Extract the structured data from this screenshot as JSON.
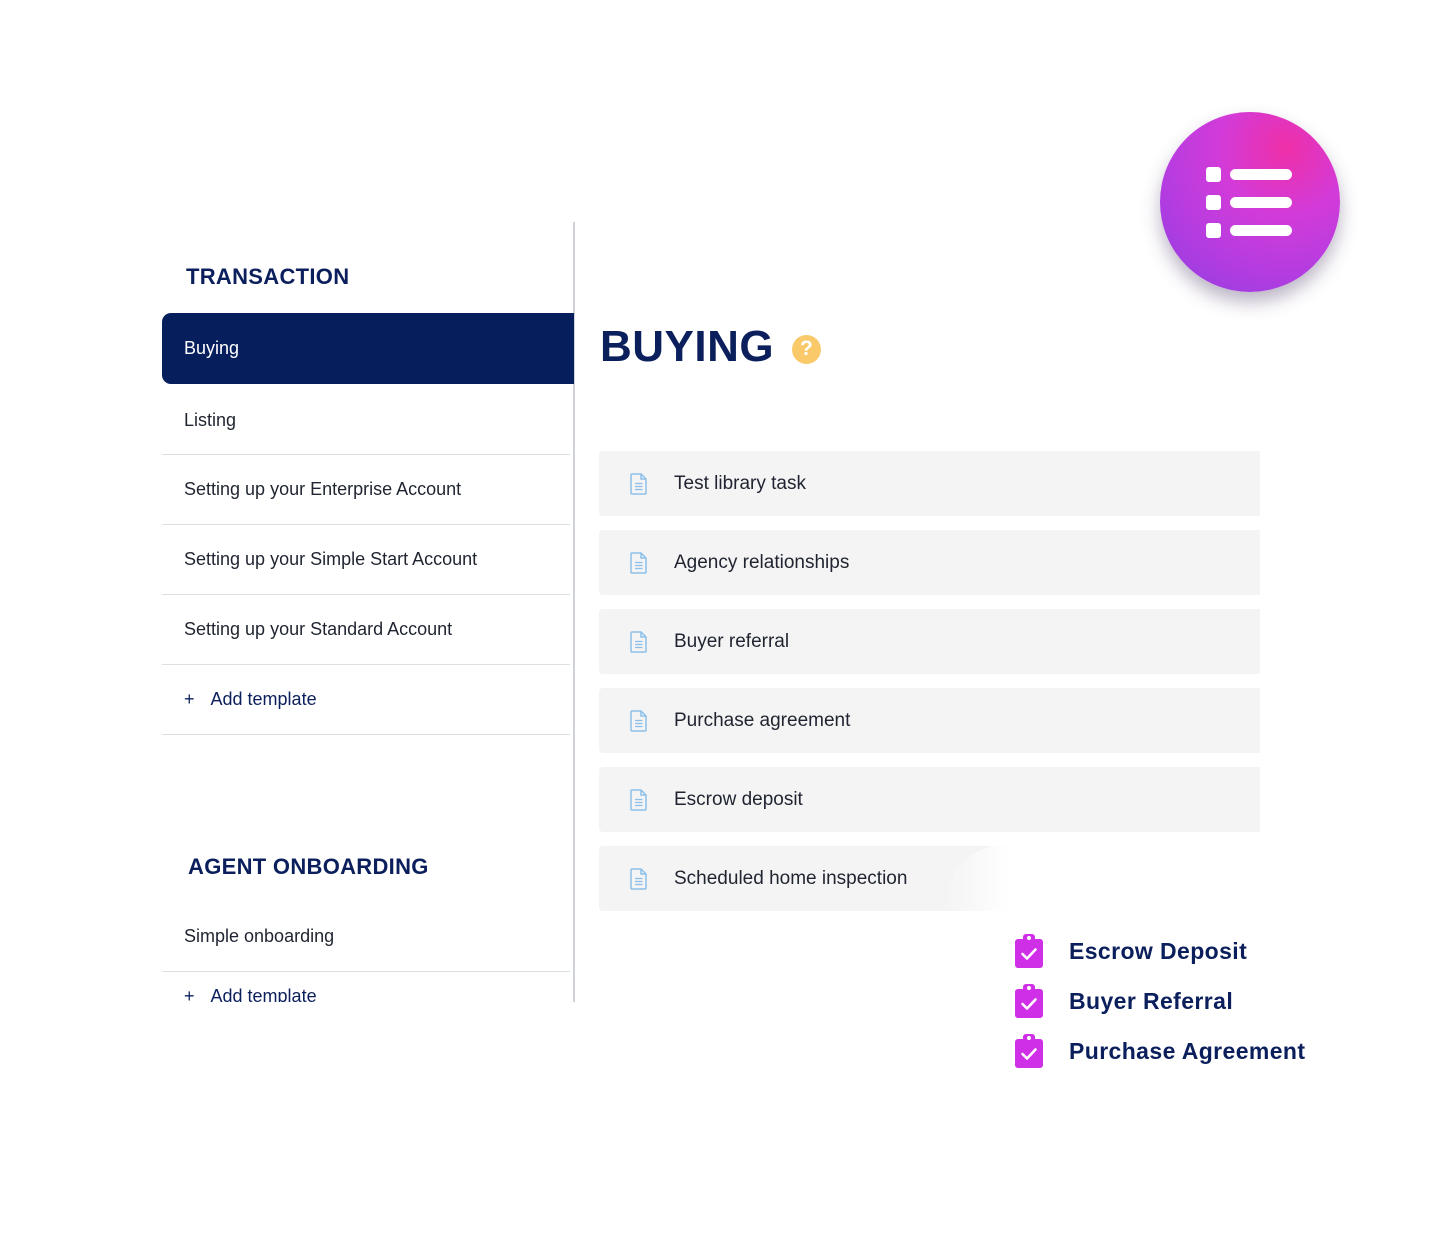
{
  "sidebar": {
    "transaction_section": {
      "title": "TRANSACTION",
      "items": [
        {
          "label": "Buying",
          "active": true
        },
        {
          "label": "Listing"
        },
        {
          "label": "Setting up your Enterprise Account"
        },
        {
          "label": "Setting up your Simple Start Account"
        },
        {
          "label": "Setting up your Standard Account"
        }
      ],
      "add_label": "Add template"
    },
    "agent_section": {
      "title": "AGENT ONBOARDING",
      "items": [
        {
          "label": "Simple onboarding"
        }
      ],
      "add_label": "Add template"
    }
  },
  "main": {
    "title": "BUYING",
    "help_icon": "question-icon",
    "tasks": [
      {
        "label": "Test library task",
        "icon": "document-icon"
      },
      {
        "label": "Agency relationships",
        "icon": "document-icon"
      },
      {
        "label": "Buyer referral",
        "icon": "document-icon"
      },
      {
        "label": "Purchase agreement",
        "icon": "document-icon"
      },
      {
        "label": "Escrow deposit",
        "icon": "document-icon"
      },
      {
        "label": "Scheduled home inspection",
        "icon": "document-icon"
      }
    ]
  },
  "badge": {
    "icon": "list-icon"
  },
  "checklist": [
    {
      "label": "Escrow Deposit",
      "icon": "clipboard-check-icon"
    },
    {
      "label": "Buyer Referral",
      "icon": "clipboard-check-icon"
    },
    {
      "label": "Purchase Agreement",
      "icon": "clipboard-check-icon"
    }
  ],
  "colors": {
    "navy": "#061f5c",
    "accent_magenta": "#d23bd9",
    "help_yellow": "#f9c96a",
    "row_bg": "#f4f4f4"
  }
}
